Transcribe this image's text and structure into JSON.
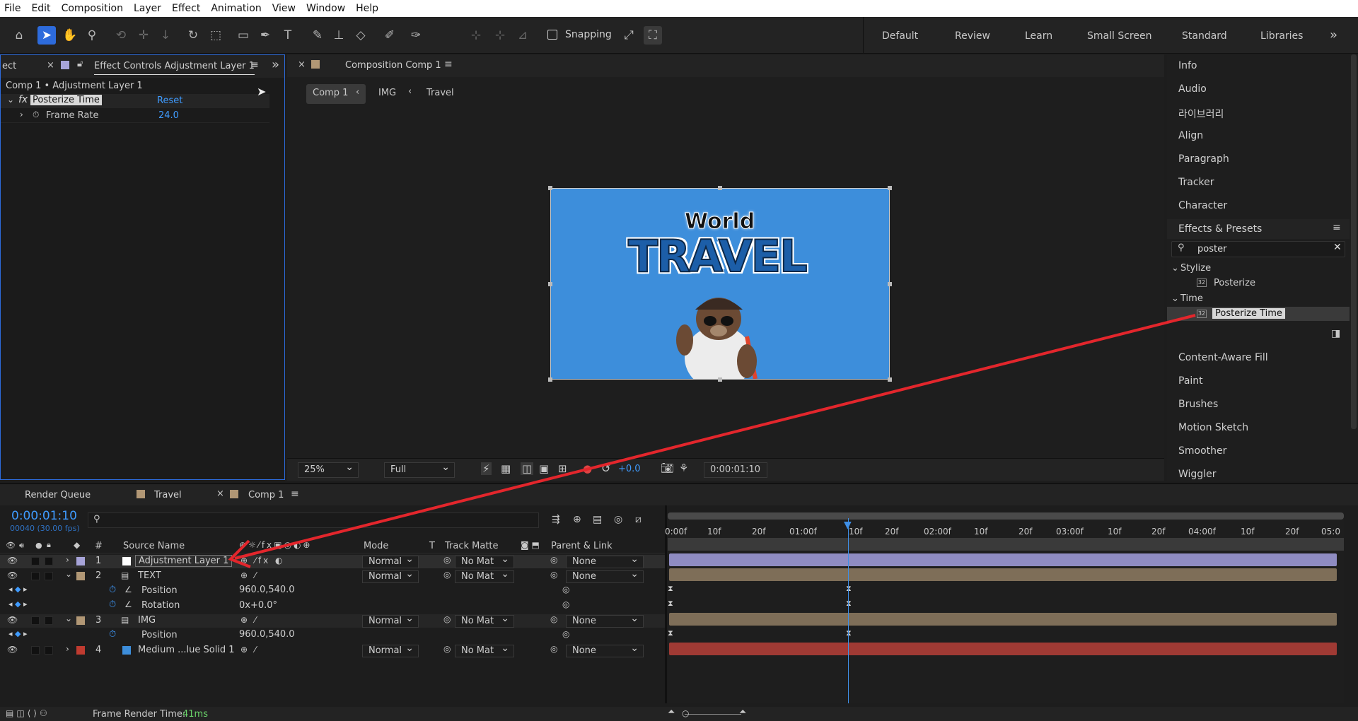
{
  "menu": [
    "File",
    "Edit",
    "Composition",
    "Layer",
    "Effect",
    "Animation",
    "View",
    "Window",
    "Help"
  ],
  "toolbar": {
    "snapping_label": "Snapping"
  },
  "workspaces": [
    "Default",
    "Review",
    "Learn",
    "Small Screen",
    "Standard",
    "Libraries"
  ],
  "effect_controls": {
    "prev_tab_partial": "ect",
    "tab_title": "Effect Controls Adjustment Layer 1",
    "breadcrumb": "Comp 1 • Adjustment Layer 1",
    "effect_name": "Posterize Time",
    "reset_label": "Reset",
    "param_name": "Frame Rate",
    "param_value": "24.0"
  },
  "composition": {
    "tab_title": "Composition Comp 1",
    "breadcrumbs": [
      "Comp 1",
      "IMG",
      "Travel"
    ],
    "zoom": "25%",
    "resolution": "Full",
    "exposure": "+0.0",
    "timecode": "0:00:01:10",
    "art_text_small": "World",
    "art_text_big": "TRAVEL"
  },
  "right_panels": {
    "items_top": [
      "Info",
      "Audio",
      "라이브러리",
      "Align",
      "Paragraph",
      "Tracker",
      "Character"
    ],
    "effects_title": "Effects & Presets",
    "search_value": "poster",
    "groups": [
      {
        "name": "Stylize",
        "items": [
          "Posterize"
        ]
      },
      {
        "name": "Time",
        "items": [
          "Posterize Time"
        ]
      }
    ],
    "items_bottom": [
      "Content-Aware Fill",
      "Paint",
      "Brushes",
      "Motion Sketch",
      "Smoother",
      "Wiggler"
    ]
  },
  "timeline": {
    "tabs": [
      "Render Queue",
      "Travel",
      "Comp 1"
    ],
    "timecode": "0:00:01:10",
    "frame_info": "00040 (30.00 fps)",
    "columns": {
      "num": "#",
      "source": "Source Name",
      "mode": "Mode",
      "t": "T",
      "track": "Track Matte",
      "parent": "Parent & Link"
    },
    "ruler": [
      "0:00f",
      "10f",
      "20f",
      "01:00f",
      "10f",
      "20f",
      "02:00f",
      "10f",
      "20f",
      "03:00f",
      "10f",
      "20f",
      "04:00f",
      "10f",
      "20f",
      "05:0"
    ],
    "layers": [
      {
        "num": "1",
        "name": "Adjustment Layer 1",
        "mode": "Normal",
        "matte": "No Mat",
        "parent": "None",
        "label": "#a7a4d9",
        "bar": "#8f8cc2"
      },
      {
        "num": "2",
        "name": "TEXT",
        "mode": "Normal",
        "matte": "No Mat",
        "parent": "None",
        "label": "#b19775",
        "bar": "#7e6e58",
        "props": [
          {
            "name": "Position",
            "value": "960.0,540.0"
          },
          {
            "name": "Rotation",
            "value": "0x+0.0°"
          }
        ]
      },
      {
        "num": "3",
        "name": "IMG",
        "mode": "Normal",
        "matte": "No Mat",
        "parent": "None",
        "label": "#b19775",
        "bar": "#7e6e58",
        "props": [
          {
            "name": "Position",
            "value": "960.0,540.0"
          }
        ]
      },
      {
        "num": "4",
        "name": "Medium ...lue Solid 1",
        "mode": "Normal",
        "matte": "No Mat",
        "parent": "None",
        "label": "#c03b30",
        "bar": "#a03a34"
      }
    ],
    "render_time_label": "Frame Render Time:",
    "render_time_value": "41ms"
  },
  "colors": {
    "accent": "#2d6bdc",
    "comp_bg": "#3d8edb",
    "arrow": "#e3262c",
    "text_blue": "#3f9bff"
  }
}
